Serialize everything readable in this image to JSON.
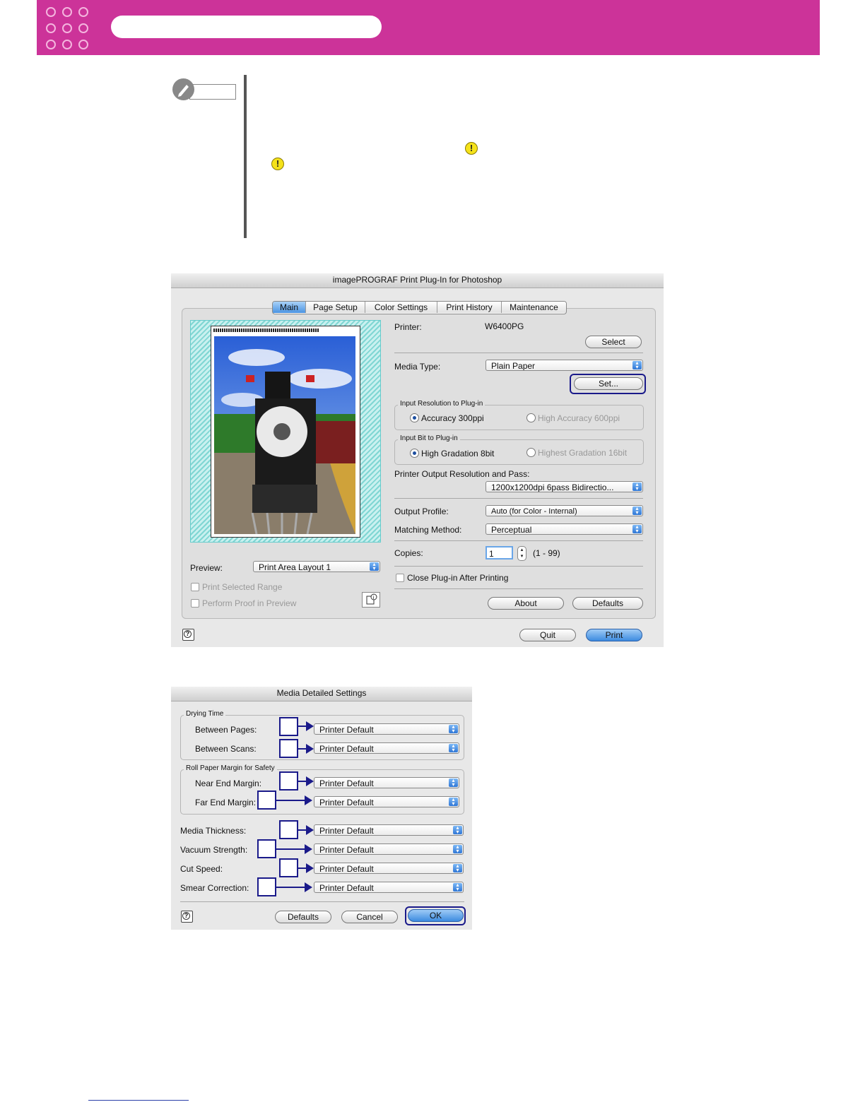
{
  "plugin_dialog": {
    "title": "imagePROGRAF Print Plug-In for Photoshop",
    "tabs": [
      "Main",
      "Page Setup",
      "Color Settings",
      "Print History",
      "Maintenance"
    ],
    "printer_label": "Printer:",
    "printer_value": "W6400PG",
    "select_button": "Select",
    "media_type_label": "Media Type:",
    "media_type_value": "Plain Paper",
    "set_button": "Set...",
    "input_resolution_title": "Input Resolution to Plug-in",
    "accuracy_300": "Accuracy 300ppi",
    "high_accuracy_600": "High Accuracy 600ppi",
    "input_bit_title": "Input Bit to Plug-in",
    "high_gradation_8bit": "High Gradation 8bit",
    "highest_gradation_16bit": "Highest Gradation 16bit",
    "output_resolution_label": "Printer Output Resolution and Pass:",
    "output_resolution_value": "1200x1200dpi 6pass Bidirectio...",
    "output_profile_label": "Output Profile:",
    "output_profile_value": "Auto (for Color - Internal)",
    "matching_method_label": "Matching Method:",
    "matching_method_value": "Perceptual",
    "copies_label": "Copies:",
    "copies_value": "1",
    "copies_range": "(1 - 99)",
    "close_plugin_label": "Close Plug-in After Printing",
    "about_button": "About",
    "defaults_button": "Defaults",
    "preview_label": "Preview:",
    "preview_value": "Print Area Layout 1",
    "print_selected_range": "Print Selected Range",
    "perform_proof": "Perform Proof in Preview",
    "quit_button": "Quit",
    "print_button": "Print"
  },
  "media_dialog": {
    "title": "Media Detailed Settings",
    "drying_time_title": "Drying Time",
    "between_pages_label": "Between Pages:",
    "between_scans_label": "Between Scans:",
    "roll_margin_title": "Roll Paper Margin for Safety",
    "near_end_label": "Near End Margin:",
    "far_end_label": "Far End Margin:",
    "media_thickness_label": "Media Thickness:",
    "vacuum_strength_label": "Vacuum Strength:",
    "cut_speed_label": "Cut Speed:",
    "smear_correction_label": "Smear Correction:",
    "default_value": "Printer Default",
    "defaults_button": "Defaults",
    "cancel_button": "Cancel",
    "ok_button": "OK"
  },
  "colors": {
    "header_band": "#cc3399",
    "callout_blue": "#1a1a8a",
    "warning_yellow": "#f5e21a"
  }
}
